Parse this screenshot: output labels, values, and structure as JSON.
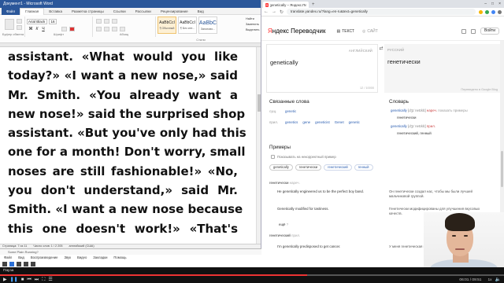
{
  "word": {
    "title": "Документ1 - Microsoft Word",
    "tabs": [
      "Файл",
      "Главная",
      "Вставка",
      "Разметка страницы",
      "Ссылки",
      "Рассылки",
      "Рецензирование",
      "Вид"
    ],
    "active_tab_index": 1,
    "font_name": "Arial Black",
    "font_size": "16",
    "groups": [
      "Буфер обмена",
      "Шрифт",
      "Абзац",
      "Стили",
      "Редактирование"
    ],
    "styles": [
      {
        "sample": "AaBbCcI",
        "name": "¶ Обычный",
        "selected": true
      },
      {
        "sample": "AaBbCcI",
        "name": "¶ Без инт...",
        "selected": false
      },
      {
        "sample": "AaBbC",
        "name": "Заголово...",
        "selected": false,
        "big": true
      }
    ],
    "find_items": [
      "Найти",
      "Заменить",
      "Выделить"
    ],
    "document_lines": [
      "assistant. «What would you like",
      "today?» «I want a new nose,» said",
      "Mr. Smith. «You already want a",
      "new nose!» said the surprised shop",
      "assistant. «But you've only had this",
      "one for a month! Don't worry, small",
      "noses are still fashionable!» «No,",
      "you don't understand,» said Mr.",
      "Smith. «I want a new nose because",
      "this one doesn't work!» «That's"
    ],
    "status": [
      "Страница: 7 из 11",
      "Число слов: 1 / 2 205",
      "английский (США)"
    ]
  },
  "player": {
    "title": "Some Plain Running?",
    "menu": [
      "Файл",
      "Вид",
      "Воспроизведение",
      "Звук",
      "Видео",
      "Закладки",
      "Помощь"
    ]
  },
  "browser": {
    "tab_title": "genetically – Яндекс.Переводчик",
    "url": "translate.yandex.ru/?lang=en-ru&text=genetically",
    "brand": {
      "logo_first": "Я",
      "logo_rest": "ндекс Переводчик"
    },
    "modes": [
      "ТЕКСТ",
      "САЙТ"
    ],
    "login": "Войти",
    "source_lang": "АНГЛИЙСКИЙ",
    "target_lang": "РУССКИЙ",
    "source_text": "genetically",
    "char_count": "12 / 10000",
    "translation": "генетически",
    "translated_by": "Переведено в Google Blog",
    "related_title": "Связанные слова",
    "related": [
      {
        "key": "сущ.",
        "words": [
          "genetic"
        ]
      },
      {
        "key": "прил.",
        "words": [
          "genetics",
          "gene",
          "geneticist",
          "Genet",
          "genetic"
        ]
      }
    ],
    "dict_title": "Словарь",
    "dict": [
      {
        "eng": "genetically",
        "ipa": "[dʒɪˈnetɪklɪ]",
        "pos": "нареч.",
        "hint": "показать примеры"
      },
      {
        "tr": "генетически"
      },
      {
        "eng": "genetically",
        "ipa": "[dʒɪˈnetɪklɪ]",
        "pos": "прил."
      },
      {
        "tr": "генетический, генный"
      }
    ],
    "examples_title": "Примеры",
    "examples_filter": "Показывать на некорректный пример",
    "chips": [
      "genetically",
      "генетически",
      "генетический",
      "генный"
    ],
    "examples": [
      {
        "head": "генетически",
        "mark": "нареч.",
        "en": "He genetically engineered us to be the perfect boy band.",
        "ru": "Он генетически создал нас, чтобы мы были лучшей мальчиковой группой."
      },
      {
        "head": "",
        "mark": "",
        "en": "Genetically modified for tastiness.",
        "ru": "Генетически модифицированы для улучшения вкусовых качеств."
      },
      {
        "head": "ещё",
        "mark": "?",
        "en": "",
        "ru": ""
      },
      {
        "head": "генетический",
        "mark": "прил.",
        "en": "I'm genetically predisposed to get cancer.",
        "ru": "У меня генетическая предрасположенность к раку."
      }
    ]
  },
  "video": {
    "label": "Пауза",
    "elapsed": "06:01 / 09:51",
    "progress": 0.61,
    "speed": "1x"
  }
}
